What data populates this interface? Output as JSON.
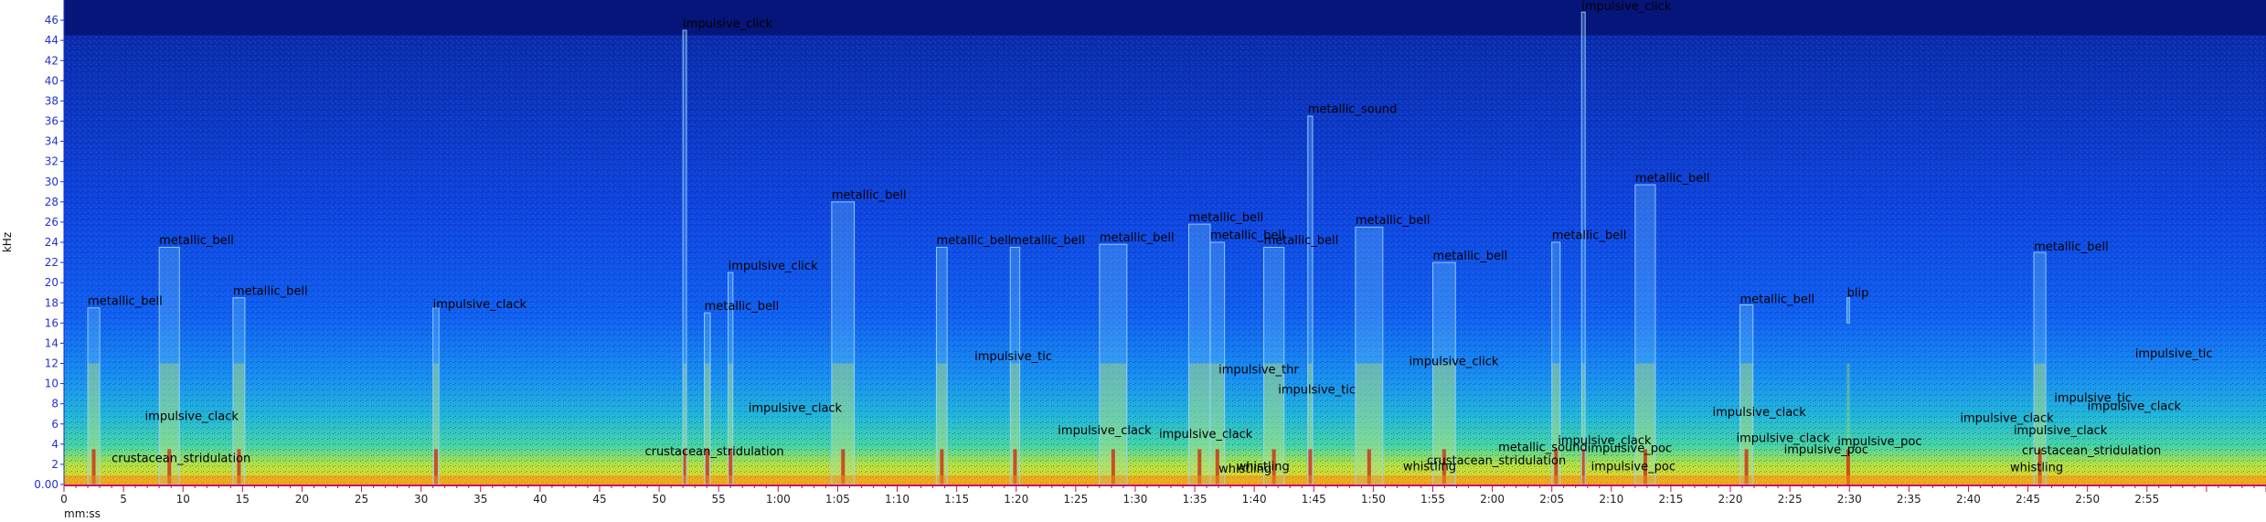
{
  "chart_data": {
    "type": "spectrogram",
    "xlabel": "mm:ss",
    "ylabel": "kHz",
    "xlim": [
      0,
      185
    ],
    "ylim": [
      0,
      48
    ],
    "x_ticks": [
      "0",
      "5",
      "10",
      "15",
      "20",
      "25",
      "30",
      "35",
      "40",
      "45",
      "50",
      "55",
      "1:00",
      "1:05",
      "1:10",
      "1:15",
      "1:20",
      "1:25",
      "1:30",
      "1:35",
      "1:40",
      "1:45",
      "1:50",
      "1:55",
      "2:00",
      "2:05",
      "2:10",
      "2:15",
      "2:20",
      "2:25",
      "2:30",
      "2:35",
      "2:40",
      "2:45",
      "2:50",
      "2:55"
    ],
    "x_tick_values": [
      0,
      5,
      10,
      15,
      20,
      25,
      30,
      35,
      40,
      45,
      50,
      55,
      60,
      65,
      70,
      75,
      80,
      85,
      90,
      95,
      100,
      105,
      110,
      115,
      120,
      125,
      130,
      135,
      140,
      145,
      150,
      155,
      160,
      165,
      170,
      175
    ],
    "y_ticks": [
      "0.00",
      "2",
      "4",
      "6",
      "8",
      "10",
      "12",
      "14",
      "16",
      "18",
      "20",
      "22",
      "24",
      "26",
      "28",
      "30",
      "32",
      "34",
      "36",
      "38",
      "40",
      "42",
      "44",
      "46"
    ],
    "y_tick_values": [
      0,
      2,
      4,
      6,
      8,
      10,
      12,
      14,
      16,
      18,
      20,
      22,
      24,
      26,
      28,
      30,
      32,
      34,
      36,
      38,
      40,
      42,
      44,
      46
    ],
    "colors": {
      "background": "#071a8c",
      "noise": "#0d3ad8",
      "low_band": "#2fd3a0",
      "floor": "#f4d21a",
      "hot": "#d02010",
      "box": "#9ed2ff"
    },
    "annotations": [
      {
        "label": "metallic_bell",
        "x0": 2.0,
        "x1": 3.0,
        "y0": 0,
        "y1": 17.5
      },
      {
        "label": "metallic_bell",
        "x0": 8.0,
        "x1": 9.7,
        "y0": 0,
        "y1": 23.5
      },
      {
        "label": "metallic_bell",
        "x0": 14.2,
        "x1": 15.2,
        "y0": 0,
        "y1": 18.5
      },
      {
        "label": "impulsive_clack",
        "x0": 31.0,
        "x1": 31.5,
        "y0": 0,
        "y1": 17.5
      },
      {
        "label": "impulsive_click",
        "x0": 52.0,
        "x1": 52.3,
        "y0": 0,
        "y1": 45.0
      },
      {
        "label": "impulsive_click",
        "x0": 55.8,
        "x1": 56.2,
        "y0": 0,
        "y1": 21.0
      },
      {
        "label": "metallic_bell",
        "x0": 53.8,
        "x1": 54.3,
        "y0": 0,
        "y1": 17.0
      },
      {
        "label": "metallic_bell",
        "x0": 64.5,
        "x1": 66.4,
        "y0": 0,
        "y1": 28.0
      },
      {
        "label": "metallic_bell",
        "x0": 73.3,
        "x1": 74.2,
        "y0": 0,
        "y1": 23.5
      },
      {
        "label": "metallic_bell",
        "x0": 79.5,
        "x1": 80.3,
        "y0": 0,
        "y1": 23.5
      },
      {
        "label": "metallic_bell",
        "x0": 87.0,
        "x1": 89.3,
        "y0": 0,
        "y1": 23.8
      },
      {
        "label": "metallic_bell",
        "x0": 94.5,
        "x1": 96.3,
        "y0": 0,
        "y1": 25.8
      },
      {
        "label": "metallic_bell",
        "x0": 96.3,
        "x1": 97.5,
        "y0": 0,
        "y1": 24.0
      },
      {
        "label": "metallic_bell",
        "x0": 100.8,
        "x1": 102.5,
        "y0": 0,
        "y1": 23.5
      },
      {
        "label": "metallic_sound",
        "x0": 104.5,
        "x1": 104.9,
        "y0": 0,
        "y1": 36.5
      },
      {
        "label": "metallic_bell",
        "x0": 108.5,
        "x1": 110.8,
        "y0": 0,
        "y1": 25.5
      },
      {
        "label": "metallic_bell",
        "x0": 115.0,
        "x1": 116.9,
        "y0": 0,
        "y1": 22.0
      },
      {
        "label": "metallic_bell",
        "x0": 125.0,
        "x1": 125.7,
        "y0": 0,
        "y1": 24.0
      },
      {
        "label": "impulsive_click",
        "x0": 127.5,
        "x1": 127.8,
        "y0": 0,
        "y1": 46.8
      },
      {
        "label": "metallic_bell",
        "x0": 132.0,
        "x1": 133.7,
        "y0": 0,
        "y1": 29.7
      },
      {
        "label": "metallic_bell",
        "x0": 140.8,
        "x1": 141.9,
        "y0": 0,
        "y1": 17.8
      },
      {
        "label": "blip",
        "x0": 149.8,
        "x1": 150.0,
        "y0": 16.0,
        "y1": 18.5
      },
      {
        "label": "metallic_bell",
        "x0": 165.5,
        "x1": 166.5,
        "y0": 0,
        "y1": 23.0
      }
    ],
    "labels": [
      {
        "text": "metallic_bell",
        "x": 2.0,
        "y": 17.8
      },
      {
        "text": "metallic_bell",
        "x": 8.0,
        "y": 23.8
      },
      {
        "text": "metallic_bell",
        "x": 14.2,
        "y": 18.8
      },
      {
        "text": "impulsive_clack",
        "x": 6.8,
        "y": 6.4
      },
      {
        "text": "crustacean_stridulation",
        "x": 4.0,
        "y": 2.2
      },
      {
        "text": "impulsive_clack",
        "x": 31.0,
        "y": 17.5
      },
      {
        "text": "impulsive_click",
        "x": 52.0,
        "y": 45.3
      },
      {
        "text": "impulsive_click",
        "x": 55.8,
        "y": 21.3
      },
      {
        "text": "metallic_bell",
        "x": 53.8,
        "y": 17.3
      },
      {
        "text": "crustacean_stridulation",
        "x": 48.8,
        "y": 2.9
      },
      {
        "text": "impulsive_clack",
        "x": 57.5,
        "y": 7.2
      },
      {
        "text": "metallic_bell",
        "x": 64.5,
        "y": 28.3
      },
      {
        "text": "metallic_bell",
        "x": 73.3,
        "y": 23.8
      },
      {
        "text": "metallic_bell",
        "x": 79.5,
        "y": 23.8
      },
      {
        "text": "impulsive_tic",
        "x": 76.5,
        "y": 12.3
      },
      {
        "text": "impulsive_clack",
        "x": 83.5,
        "y": 5.0
      },
      {
        "text": "metallic_bell",
        "x": 87.0,
        "y": 24.1
      },
      {
        "text": "metallic_bell",
        "x": 94.5,
        "y": 26.1
      },
      {
        "text": "metallic_bell",
        "x": 96.3,
        "y": 24.3
      },
      {
        "text": "metallic_bell",
        "x": 100.8,
        "y": 23.8
      },
      {
        "text": "impulsive_clack",
        "x": 92.0,
        "y": 4.6
      },
      {
        "text": "impulsive_thr",
        "x": 97.0,
        "y": 11.0
      },
      {
        "text": "whistling",
        "x": 97.0,
        "y": 1.2
      },
      {
        "text": "whistling",
        "x": 98.5,
        "y": 1.4
      },
      {
        "text": "impulsive_tic",
        "x": 102.0,
        "y": 9.0
      },
      {
        "text": "metallic_sound",
        "x": 104.5,
        "y": 36.8
      },
      {
        "text": "metallic_bell",
        "x": 108.5,
        "y": 25.8
      },
      {
        "text": "metallic_bell",
        "x": 115.0,
        "y": 22.3
      },
      {
        "text": "impulsive_click",
        "x": 113.0,
        "y": 11.8
      },
      {
        "text": "whistling",
        "x": 112.5,
        "y": 1.4
      },
      {
        "text": "crustacean_stridulation",
        "x": 114.5,
        "y": 2.0
      },
      {
        "text": "metallic_sound",
        "x": 120.5,
        "y": 3.3
      },
      {
        "text": "metallic_bell",
        "x": 125.0,
        "y": 24.3
      },
      {
        "text": "impulsive_click",
        "x": 127.5,
        "y": 47.0
      },
      {
        "text": "impulsive_clack",
        "x": 125.5,
        "y": 4.0
      },
      {
        "text": "impulsive_poc",
        "x": 128.0,
        "y": 3.2
      },
      {
        "text": "impulsive_poc",
        "x": 128.3,
        "y": 1.4
      },
      {
        "text": "metallic_bell",
        "x": 132.0,
        "y": 30.0
      },
      {
        "text": "impulsive_clack",
        "x": 138.5,
        "y": 6.8
      },
      {
        "text": "metallic_bell",
        "x": 140.8,
        "y": 18.0
      },
      {
        "text": "impulsive_clack",
        "x": 140.5,
        "y": 4.2
      },
      {
        "text": "impulsive_poc",
        "x": 144.5,
        "y": 3.1
      },
      {
        "text": "impulsive_poc",
        "x": 149.0,
        "y": 3.9
      },
      {
        "text": "blip",
        "x": 149.8,
        "y": 18.6
      },
      {
        "text": "metallic_bell",
        "x": 165.5,
        "y": 23.2
      },
      {
        "text": "impulsive_clack",
        "x": 159.3,
        "y": 6.2
      },
      {
        "text": "impulsive_tic",
        "x": 167.2,
        "y": 8.2
      },
      {
        "text": "impulsive_clack",
        "x": 170.0,
        "y": 7.4
      },
      {
        "text": "impulsive_clack",
        "x": 163.8,
        "y": 5.0
      },
      {
        "text": "whistling",
        "x": 163.5,
        "y": 1.3
      },
      {
        "text": "crustacean_stridulation",
        "x": 164.5,
        "y": 3.0
      },
      {
        "text": "impulsive_tic",
        "x": 174.0,
        "y": 12.6
      }
    ]
  }
}
